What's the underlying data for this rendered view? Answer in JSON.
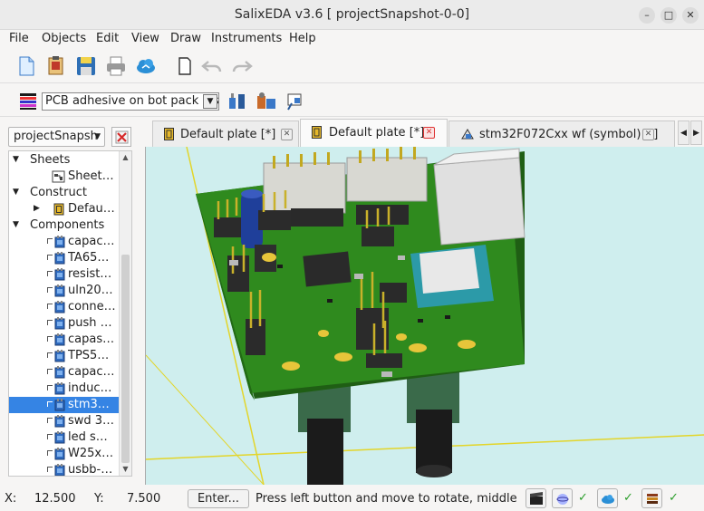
{
  "window": {
    "title": "SalixEDA v3.6 [ projectSnapshot-0-0]",
    "minimize_glyph": "–",
    "maximize_glyph": "□",
    "close_glyph": "✕"
  },
  "menu": {
    "file": "File",
    "objects": "Objects",
    "edit": "Edit",
    "view": "View",
    "draw": "Draw",
    "instruments": "Instruments",
    "help": "Help"
  },
  "toolbar": {
    "icons": [
      "new-file-icon",
      "open-icon",
      "save-icon",
      "print-icon",
      "cloud-icon",
      "page-icon",
      "undo-icon",
      "redo-icon"
    ]
  },
  "layer_toolbar": {
    "layer_select": "PCB adhesive on bot pack last",
    "icons": [
      "layer-color-icon",
      "components-icon",
      "library-icon",
      "pin-icon"
    ]
  },
  "project": {
    "combo_value": "projectSnapsh"
  },
  "tree": {
    "sheets_label": "Sheets",
    "sheet_item": "Sheet…",
    "construct_label": "Construct",
    "construct_item": "Defau…",
    "components_label": "Components",
    "components": [
      "capac…",
      "TA65…",
      "resist…",
      "uln20…",
      "conne…",
      "push …",
      "capas…",
      "TPS5…",
      "capac…",
      "induc…",
      "stm3…",
      "swd 3…",
      "led s…",
      "W25x…",
      "usbb-…"
    ],
    "selected_index": 10
  },
  "tabs": [
    {
      "label": "Default plate [*]",
      "active": false
    },
    {
      "label": "Default plate [*]",
      "active": true
    },
    {
      "label": "stm32F072Cxx wf (symbol) [-]",
      "active": false
    }
  ],
  "status": {
    "x_label": "X:",
    "x_value": "12.500",
    "y_label": "Y:",
    "y_value": "7.500",
    "enter_button": "Enter...",
    "hint": "Press left button and move to rotate, middle butt",
    "check_glyph": "✓"
  },
  "colors": {
    "pcb": "#2f8a1e",
    "viewport_bg": "#cfeeee",
    "selection": "#3584e4"
  }
}
